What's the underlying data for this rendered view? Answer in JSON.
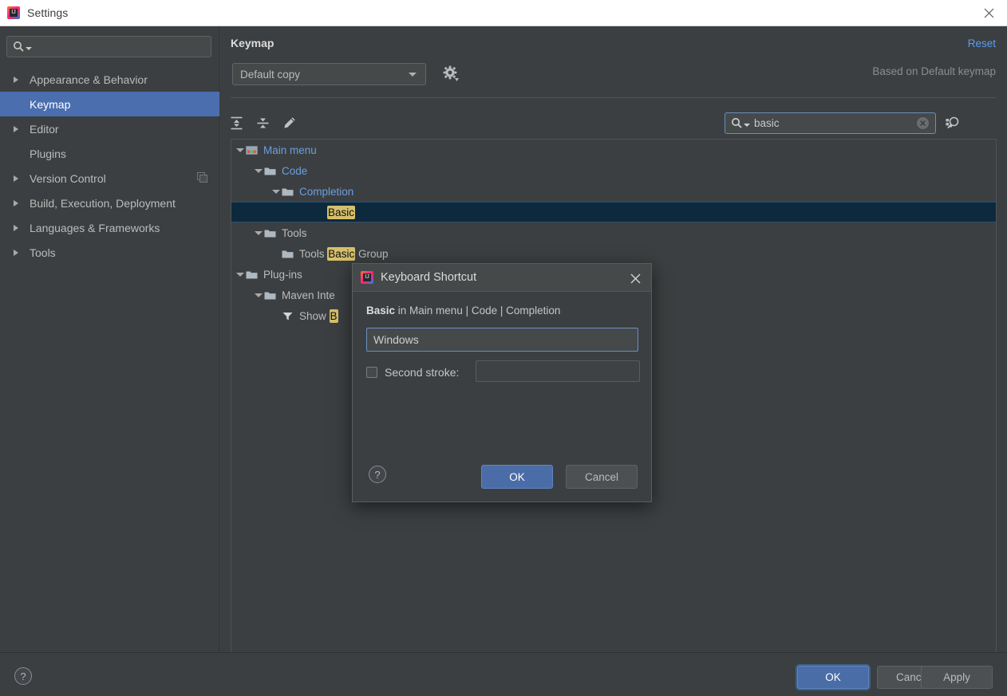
{
  "window": {
    "title": "Settings",
    "app_icon": "intellij-idea-icon",
    "close_icon": "close-icon"
  },
  "sidebar": {
    "search": {
      "placeholder": "",
      "value": "",
      "icon": "search-icon"
    },
    "items": [
      {
        "label": "Appearance & Behavior",
        "expandable": true,
        "selected": false,
        "trailing_icon": ""
      },
      {
        "label": "Keymap",
        "expandable": false,
        "selected": true,
        "trailing_icon": ""
      },
      {
        "label": "Editor",
        "expandable": true,
        "selected": false,
        "trailing_icon": ""
      },
      {
        "label": "Plugins",
        "expandable": false,
        "selected": false,
        "trailing_icon": ""
      },
      {
        "label": "Version Control",
        "expandable": true,
        "selected": false,
        "trailing_icon": "copy-icon"
      },
      {
        "label": "Build, Execution, Deployment",
        "expandable": true,
        "selected": false,
        "trailing_icon": ""
      },
      {
        "label": "Languages & Frameworks",
        "expandable": true,
        "selected": false,
        "trailing_icon": ""
      },
      {
        "label": "Tools",
        "expandable": true,
        "selected": false,
        "trailing_icon": ""
      }
    ]
  },
  "main": {
    "page_title": "Keymap",
    "reset_label": "Reset",
    "keymap_combo": {
      "value": "Default copy",
      "icon": "chevron-down-icon"
    },
    "gear_icon": "gear-icon",
    "based_on": "Based on Default keymap",
    "toolbar": {
      "expand_all_icon": "expand-all-icon",
      "collapse_all_icon": "collapse-all-icon",
      "edit_icon": "pencil-edit-icon"
    },
    "find": {
      "value": "basic",
      "placeholder": "",
      "search_icon": "search-icon",
      "clear_icon": "clear-circle-icon",
      "by_shortcut_icon": "find-by-shortcut-icon"
    },
    "tree": [
      {
        "indent": 0,
        "toggle": "expanded",
        "icon": "main-menu-icon",
        "parts": [
          {
            "t": "Main menu",
            "hl": false
          }
        ],
        "blue": true,
        "selected": false
      },
      {
        "indent": 1,
        "toggle": "expanded",
        "icon": "folder-icon",
        "parts": [
          {
            "t": "Code",
            "hl": false
          }
        ],
        "blue": true,
        "selected": false
      },
      {
        "indent": 2,
        "toggle": "expanded",
        "icon": "folder-icon",
        "parts": [
          {
            "t": "Completion",
            "hl": false
          }
        ],
        "blue": true,
        "selected": false
      },
      {
        "indent": 4,
        "toggle": "none",
        "icon": "",
        "parts": [
          {
            "t": "Basic",
            "hl": true
          }
        ],
        "blue": false,
        "selected": true
      },
      {
        "indent": 1,
        "toggle": "expanded",
        "icon": "folder-icon",
        "parts": [
          {
            "t": "Tools",
            "hl": false
          }
        ],
        "blue": false,
        "selected": false
      },
      {
        "indent": 2,
        "toggle": "none",
        "icon": "folder-icon",
        "parts": [
          {
            "t": "Tools ",
            "hl": false
          },
          {
            "t": "Basic",
            "hl": true
          },
          {
            "t": " Group",
            "hl": false
          }
        ],
        "blue": false,
        "selected": false
      },
      {
        "indent": 0,
        "toggle": "expanded",
        "icon": "folder-icon",
        "parts": [
          {
            "t": "Plug-ins",
            "hl": false
          }
        ],
        "blue": false,
        "selected": false
      },
      {
        "indent": 1,
        "toggle": "expanded",
        "icon": "folder-icon",
        "parts": [
          {
            "t": "Maven Inte",
            "hl": false
          }
        ],
        "blue": false,
        "selected": false
      },
      {
        "indent": 2,
        "toggle": "none",
        "icon": "filter-icon",
        "parts": [
          {
            "t": "Show ",
            "hl": false
          },
          {
            "t": "B",
            "hl": true
          }
        ],
        "blue": false,
        "selected": false
      }
    ]
  },
  "dialog": {
    "title": "Keyboard Shortcut",
    "app_icon": "intellij-idea-icon",
    "close_icon": "close-icon",
    "description_bold": "Basic",
    "description_rest": " in Main menu | Code | Completion",
    "first_stroke": {
      "value": "Windows",
      "placeholder": ""
    },
    "second_stroke": {
      "label": "Second stroke:",
      "checked": false,
      "value": "",
      "placeholder": ""
    },
    "help_label": "?",
    "ok_label": "OK",
    "cancel_label": "Cancel"
  },
  "footer": {
    "help_label": "?",
    "ok_label": "OK",
    "cancel_label": "Cancel",
    "apply_label": "Apply"
  },
  "colors": {
    "background": "#3c3f41",
    "panel": "#45494a",
    "accent_blue": "#4b6eaf",
    "link_blue": "#589df6",
    "tree_blue": "#6a9fe0",
    "highlight_yellow": "#d6c06b",
    "selected_row": "#0d293e",
    "titlebar": "#ffffff"
  }
}
